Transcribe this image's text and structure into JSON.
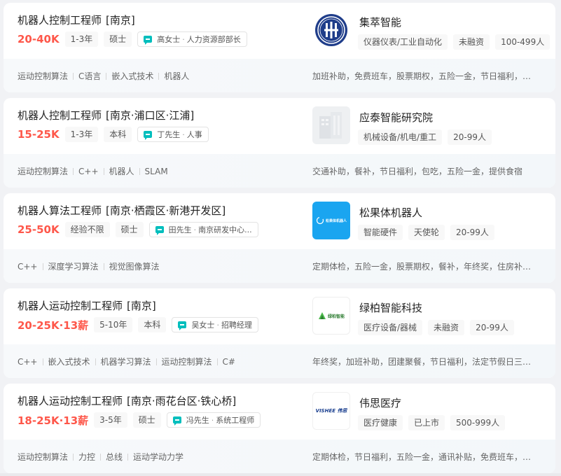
{
  "jobs": [
    {
      "title": "机器人控制工程师",
      "area": "[南京]",
      "salary": "20-40K",
      "tags": [
        "1-3年",
        "硕士"
      ],
      "recruiter": {
        "name": "高女士",
        "role": "人力资源部部长"
      },
      "skills": [
        "运动控制算法",
        "C语言",
        "嵌入式技术",
        "机器人"
      ],
      "company": {
        "name": "集萃智能",
        "tags": [
          "仪器仪表/工业自动化",
          "未融资",
          "100-499人"
        ],
        "logo_icon": "seal-logo-icon"
      },
      "welfare": "加班补助，免费班车，股票期权，五险一金，节日福利，员..."
    },
    {
      "title": "机器人控制工程师",
      "area": "[南京·浦口区·江浦]",
      "salary": "15-25K",
      "tags": [
        "1-3年",
        "本科"
      ],
      "recruiter": {
        "name": "丁先生",
        "role": "人事"
      },
      "skills": [
        "运动控制算法",
        "C++",
        "机器人",
        "SLAM"
      ],
      "company": {
        "name": "应泰智能研究院",
        "tags": [
          "机械设备/机电/重工",
          "20-99人"
        ],
        "logo_icon": "building-logo-icon"
      },
      "welfare": "交通补助，餐补，节日福利，包吃，五险一金，提供食宿"
    },
    {
      "title": "机器人算法工程师",
      "area": "[南京·栖霞区·新港开发区]",
      "salary": "25-50K",
      "tags": [
        "经验不限",
        "硕士"
      ],
      "recruiter": {
        "name": "田先生",
        "role": "南京研发中心..."
      },
      "skills": [
        "C++",
        "深度学习算法",
        "视觉图像算法"
      ],
      "company": {
        "name": "松果体机器人",
        "tags": [
          "智能硬件",
          "天使轮",
          "20-99人"
        ],
        "logo_icon": "songguo-logo-icon",
        "logo_text": "松果体机器人"
      },
      "welfare": "定期体检，五险一金，股票期权，餐补，年终奖，住房补贴..."
    },
    {
      "title": "机器人运动控制工程师",
      "area": "[南京]",
      "salary": "20-25K·13薪",
      "tags": [
        "5-10年",
        "本科"
      ],
      "recruiter": {
        "name": "吴女士",
        "role": "招聘经理"
      },
      "skills": [
        "C++",
        "嵌入式技术",
        "机器学习算法",
        "运动控制算法",
        "C#"
      ],
      "company": {
        "name": "绿柏智能科技",
        "tags": [
          "医疗设备/器械",
          "未融资",
          "20-99人"
        ],
        "logo_icon": "lvbai-logo-icon",
        "logo_text": "绿柏智能"
      },
      "welfare": "年终奖，加班补助，团建聚餐，节日福利，法定节假日三薪..."
    },
    {
      "title": "机器人运动控制工程师",
      "area": "[南京·雨花台区·铁心桥]",
      "salary": "18-25K·13薪",
      "tags": [
        "3-5年",
        "硕士"
      ],
      "recruiter": {
        "name": "冯先生",
        "role": "系统工程师"
      },
      "skills": [
        "运动控制算法",
        "力控",
        "总线",
        "运动学动力学"
      ],
      "company": {
        "name": "伟思医疗",
        "tags": [
          "医疗健康",
          "已上市",
          "500-999人"
        ],
        "logo_icon": "visheee-logo-icon",
        "logo_text": "VISHEE 伟思"
      },
      "welfare": "定期体检，节日福利，五险一金，通讯补贴，免费班车，年..."
    }
  ],
  "colors": {
    "salary": "#fe574a",
    "chat_accent": "#00bebd",
    "seal_blue": "#1f3d8a",
    "songguo_blue": "#1aa5f0",
    "lvbai_green": "#4ab84a"
  }
}
